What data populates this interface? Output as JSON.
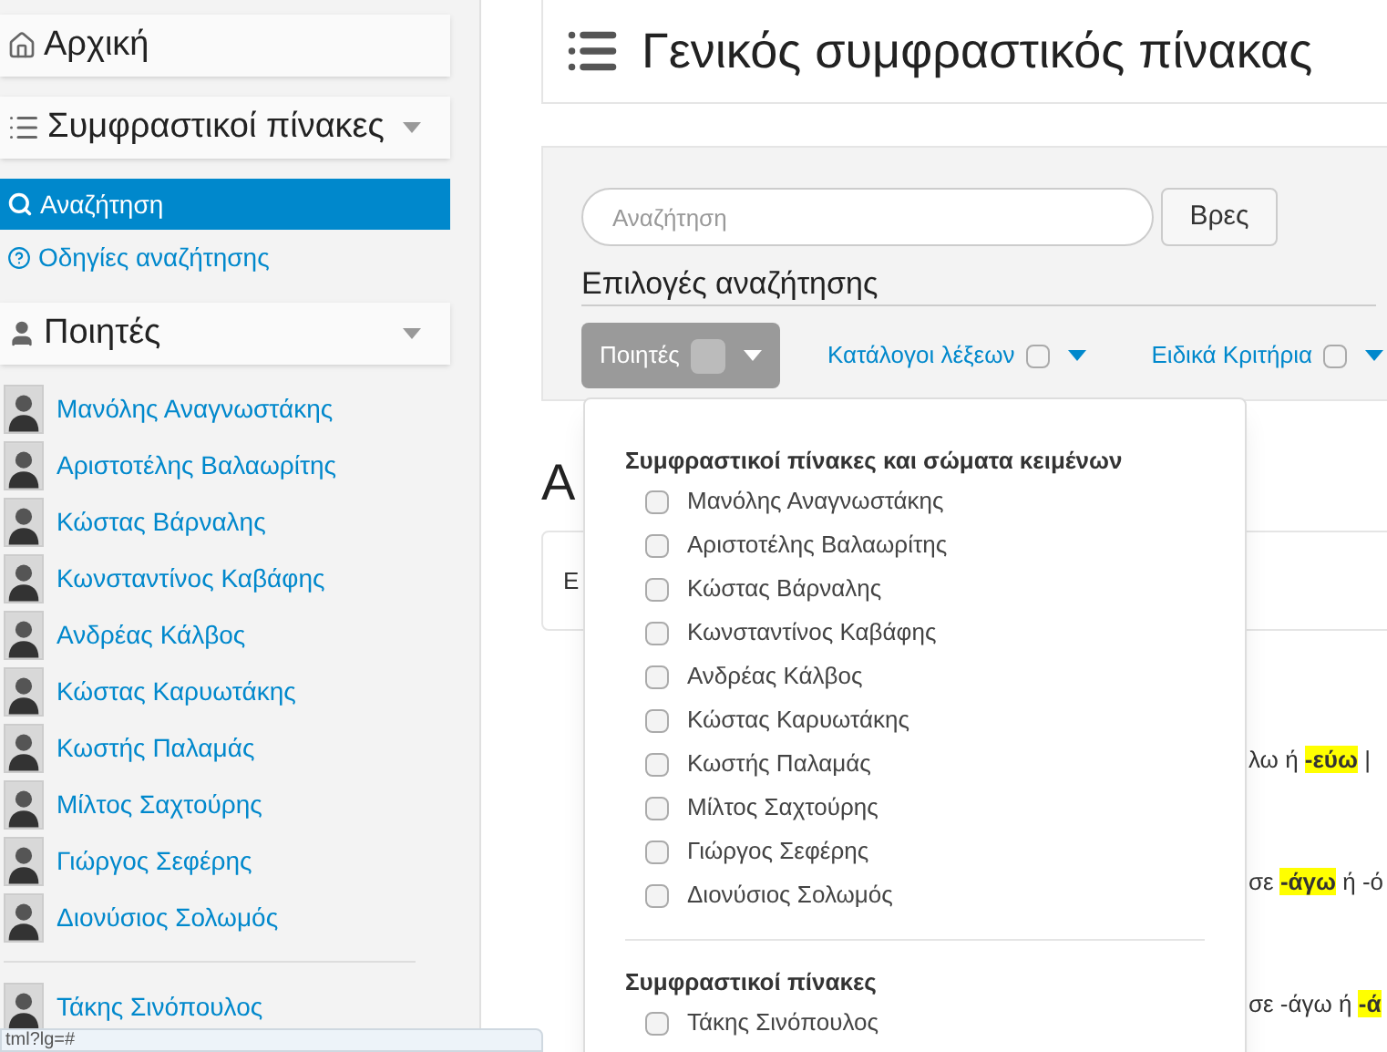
{
  "sidebar": {
    "home": {
      "label": "Αρχική"
    },
    "concordances": {
      "label": "Συμφραστικοί πίνακες",
      "items": [
        {
          "label": "Αναζήτηση",
          "kind": "search",
          "selected": true
        },
        {
          "label": "Οδηγίες αναζήτησης",
          "kind": "help",
          "selected": false
        }
      ]
    },
    "poets": {
      "label": "Ποιητές",
      "items": [
        "Μανόλης Αναγνωστάκης",
        "Αριστοτέλης Βαλαωρίτης",
        "Κώστας Βάρναλης",
        "Κωνσταντίνος Καβάφης",
        "Ανδρέας Κάλβος",
        "Κώστας Καρυωτάκης",
        "Κωστής Παλαμάς",
        "Μίλτος Σαχτούρης",
        "Γιώργος Σεφέρης",
        "Διονύσιος Σολωμός"
      ],
      "more_items": [
        "Τάκης Σινόπουλος"
      ]
    }
  },
  "status_bar": "tml?lg=#",
  "page_title": "Γενικός συμφραστικός πίνακας",
  "search": {
    "placeholder": "Αναζήτηση",
    "button": "Βρες",
    "options_title": "Επιλογές αναζήτησης",
    "filters": [
      {
        "label": "Ποιητές",
        "active": true,
        "checked": false
      },
      {
        "label": "Κατάλογοι λέξεων",
        "active": false,
        "checked": false
      },
      {
        "label": "Ειδικά Κριτήρια",
        "active": false,
        "checked": false
      }
    ]
  },
  "dropdown": {
    "groups": [
      {
        "title": "Συμφραστικοί πίνακες και σώματα κειμένων",
        "options": [
          {
            "label": "Μανόλης Αναγνωστάκης",
            "checked": false
          },
          {
            "label": "Αριστοτέλης Βαλαωρίτης",
            "checked": false
          },
          {
            "label": "Κώστας Βάρναλης",
            "checked": false
          },
          {
            "label": "Κωνσταντίνος Καβάφης",
            "checked": false
          },
          {
            "label": "Ανδρέας Κάλβος",
            "checked": false
          },
          {
            "label": "Κώστας Καρυωτάκης",
            "checked": false
          },
          {
            "label": "Κωστής Παλαμάς",
            "checked": false
          },
          {
            "label": "Μίλτος Σαχτούρης",
            "checked": false
          },
          {
            "label": "Γιώργος Σεφέρης",
            "checked": false
          },
          {
            "label": "Διονύσιος Σολωμός",
            "checked": false
          }
        ]
      },
      {
        "title": "Συμφραστικοί πίνακες",
        "options": [
          {
            "label": "Τάκης Σινόπουλος",
            "checked": false
          }
        ]
      }
    ]
  },
  "behind": {
    "heading": "Α",
    "box_text": "Ε",
    "results": [
      [
        {
          "text": "λω ή ",
          "highlight": false
        },
        {
          "text": "-εύω",
          "highlight": true
        },
        {
          "text": " |",
          "highlight": false
        }
      ],
      [
        {
          "text": "σε ",
          "highlight": false
        },
        {
          "text": "-άγω",
          "highlight": true
        },
        {
          "text": " ή -ό",
          "highlight": false
        }
      ],
      [
        {
          "text": "σε -άγω ή ",
          "highlight": false
        },
        {
          "text": "-ά",
          "highlight": true
        }
      ]
    ]
  }
}
